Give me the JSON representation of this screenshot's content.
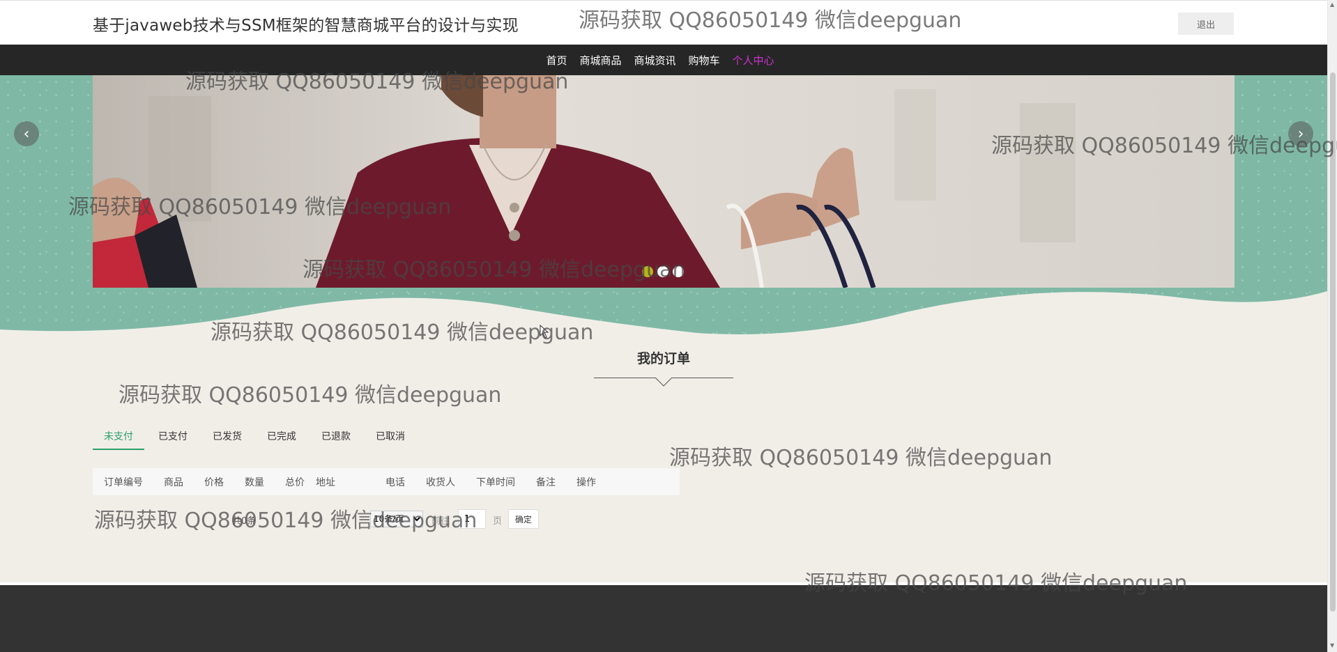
{
  "header": {
    "site_title": "基于javaweb技术与SSM框架的智慧商城平台的设计与实现",
    "logout_label": "退出"
  },
  "nav": {
    "items": [
      {
        "label": "首页",
        "active": false
      },
      {
        "label": "商城商品",
        "active": false
      },
      {
        "label": "商城资讯",
        "active": false
      },
      {
        "label": "购物车",
        "active": false
      },
      {
        "label": "个人中心",
        "active": true
      }
    ],
    "active_color": "#d230d6"
  },
  "carousel": {
    "prev_icon": "chevron-left-icon",
    "next_icon": "chevron-right-icon",
    "slide_count": 3,
    "active_slide": 1,
    "active_dot_color": "#b8b51a"
  },
  "section": {
    "title": "我的订单"
  },
  "tabs": [
    {
      "label": "未支付",
      "active": true
    },
    {
      "label": "已支付",
      "active": false
    },
    {
      "label": "已发货",
      "active": false
    },
    {
      "label": "已完成",
      "active": false
    },
    {
      "label": "已退款",
      "active": false
    },
    {
      "label": "已取消",
      "active": false
    }
  ],
  "table": {
    "columns": [
      "订单编号",
      "商品",
      "价格",
      "数量",
      "总价",
      "地址",
      "电话",
      "收货人",
      "下单时间",
      "备注",
      "操作"
    ]
  },
  "pagination": {
    "total_text": "共0条",
    "page_size": "10条/页",
    "goto_label": "前往",
    "page_value": "1",
    "page_unit": "页",
    "confirm_label": "确定"
  },
  "watermark": {
    "text": "源码获取 QQ86050149 微信deepguan"
  },
  "colors": {
    "accent": "#2aa06a",
    "nav_bg": "#262626",
    "banner_bg": "#7fb9a6",
    "footer_bg": "#333333"
  }
}
